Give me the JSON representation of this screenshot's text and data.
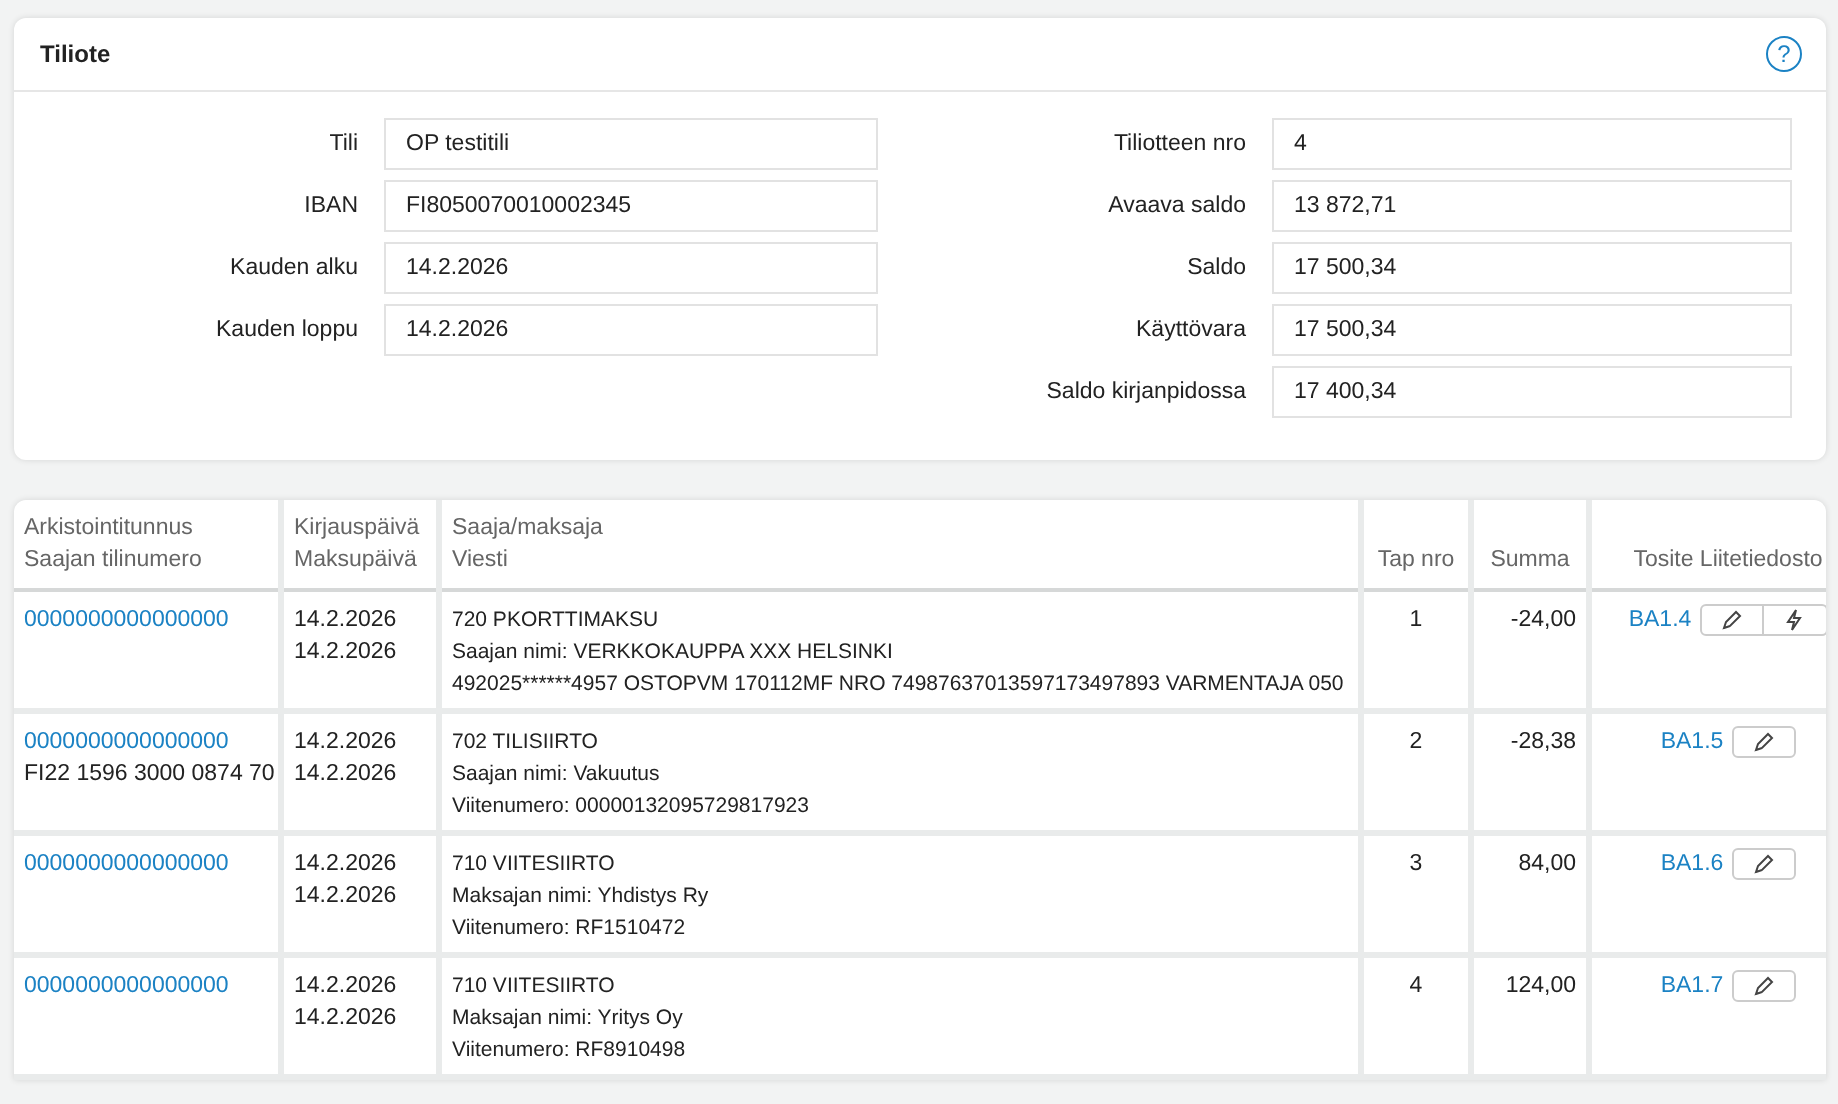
{
  "panel": {
    "title": "Tiliote",
    "help_icon": "?"
  },
  "fields_left": [
    {
      "label": "Tili",
      "value": "OP testitili"
    },
    {
      "label": "IBAN",
      "value": "FI8050070010002345"
    },
    {
      "label": "Kauden alku",
      "value": "14.2.2026"
    },
    {
      "label": "Kauden loppu",
      "value": "14.2.2026"
    }
  ],
  "fields_right": [
    {
      "label": "Tiliotteen nro",
      "value": "4"
    },
    {
      "label": "Avaava saldo",
      "value": "13 872,71"
    },
    {
      "label": "Saldo",
      "value": "17 500,34"
    },
    {
      "label": "Käyttövara",
      "value": "17 500,34"
    },
    {
      "label": "Saldo kirjanpidossa",
      "value": "17 400,34"
    }
  ],
  "table": {
    "columns": [
      [
        "Arkistointitunnus",
        "Saajan tilinumero"
      ],
      [
        "Kirjauspäivä",
        "Maksupäivä"
      ],
      [
        "Saaja/maksaja",
        "Viesti"
      ],
      [
        "Tap nro"
      ],
      [
        "Summa"
      ],
      [
        "Tosite Liitetiedosto"
      ]
    ],
    "rows": [
      {
        "archive_id": "0000000000000000",
        "account": "",
        "booking_date": "14.2.2026",
        "payment_date": "14.2.2026",
        "message": [
          "720 PKORTTIMAKSU",
          "Saajan nimi: VERKKOKAUPPA XXX HELSINKI",
          "492025******4957 OSTOPVM 170112MF NRO 74987637013597173497893 VARMENTAJA 050"
        ],
        "number": "1",
        "amount": "-24,00",
        "voucher": "BA1.4",
        "buttons": [
          {
            "kind": "edit"
          },
          {
            "kind": "bolt"
          }
        ]
      },
      {
        "archive_id": "0000000000000000",
        "account": "FI22 1596 3000 0874 70",
        "booking_date": "14.2.2026",
        "payment_date": "14.2.2026",
        "message": [
          "702 TILISIIRTO",
          "Saajan nimi: Vakuutus",
          "Viitenumero: 00000132095729817923"
        ],
        "number": "2",
        "amount": "-28,38",
        "voucher": "BA1.5",
        "buttons": [
          {
            "kind": "edit"
          }
        ]
      },
      {
        "archive_id": "0000000000000000",
        "account": "",
        "booking_date": "14.2.2026",
        "payment_date": "14.2.2026",
        "message": [
          "710 VIITESIIRTO",
          "Maksajan nimi: Yhdistys Ry",
          "Viitenumero: RF1510472"
        ],
        "number": "3",
        "amount": "84,00",
        "voucher": "BA1.6",
        "buttons": [
          {
            "kind": "edit"
          }
        ]
      },
      {
        "archive_id": "0000000000000000",
        "account": "",
        "booking_date": "14.2.2026",
        "payment_date": "14.2.2026",
        "message": [
          "710 VIITESIIRTO",
          "Maksajan nimi: Yritys Oy",
          "Viitenumero: RF8910498"
        ],
        "number": "4",
        "amount": "124,00",
        "voucher": "BA1.7",
        "buttons": [
          {
            "kind": "edit"
          }
        ]
      }
    ]
  }
}
